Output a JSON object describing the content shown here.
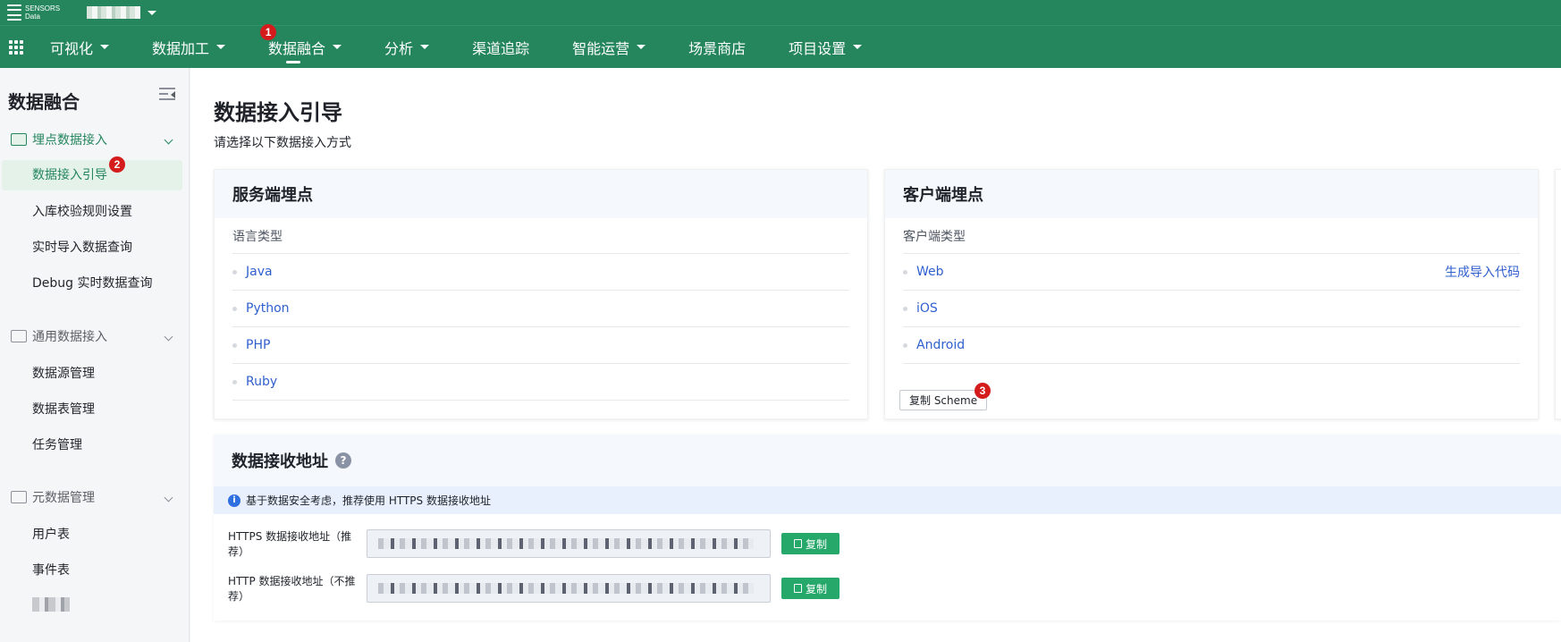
{
  "topbar": {
    "logo_line1": "SENSORS",
    "logo_line2": "Data"
  },
  "nav": {
    "items": [
      {
        "label": "可视化",
        "has_caret": true
      },
      {
        "label": "数据加工",
        "has_caret": true
      },
      {
        "label": "数据融合",
        "has_caret": true,
        "active": true
      },
      {
        "label": "分析",
        "has_caret": true
      },
      {
        "label": "渠道追踪",
        "has_caret": false
      },
      {
        "label": "智能运营",
        "has_caret": true
      },
      {
        "label": "场景商店",
        "has_caret": false
      },
      {
        "label": "项目设置",
        "has_caret": true
      }
    ],
    "badge1": "1"
  },
  "sidebar": {
    "title": "数据融合",
    "groups": [
      {
        "label": "埋点数据接入",
        "items": [
          "数据接入引导",
          "入库校验规则设置",
          "实时导入数据查询",
          "Debug 实时数据查询"
        ]
      },
      {
        "label": "通用数据接入",
        "items": [
          "数据源管理",
          "数据表管理",
          "任务管理"
        ]
      },
      {
        "label": "元数据管理",
        "items": [
          "用户表",
          "事件表"
        ]
      }
    ],
    "badge2": "2"
  },
  "main": {
    "title": "数据接入引导",
    "subtitle": "请选择以下数据接入方式",
    "server_card": {
      "title": "服务端埋点",
      "sub": "语言类型",
      "items": [
        "Java",
        "Python",
        "PHP",
        "Ruby"
      ]
    },
    "client_card": {
      "title": "客户端埋点",
      "sub": "客户端类型",
      "items": [
        "Web",
        "iOS",
        "Android"
      ],
      "gen_code_link": "生成导入代码",
      "copy_scheme": "复制 Scheme",
      "badge3": "3"
    },
    "addr_card": {
      "title": "数据接收地址",
      "help": "?",
      "info": "基于数据安全考虑，推荐使用 HTTPS 数据接收地址",
      "https_label": "HTTPS 数据接收地址（推荐）",
      "http_label": "HTTP 数据接收地址（不推荐）",
      "copy_label": "复制"
    }
  }
}
